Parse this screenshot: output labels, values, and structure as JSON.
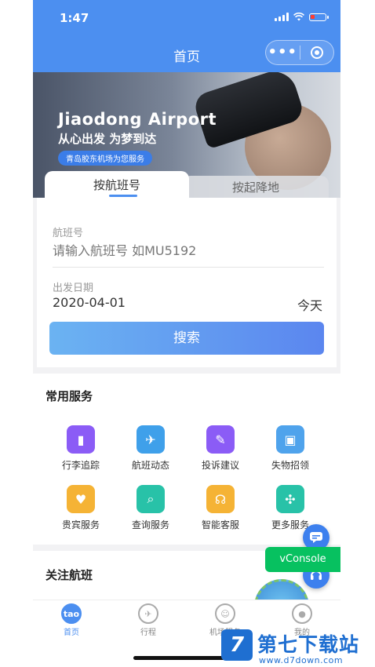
{
  "status": {
    "time": "1:47"
  },
  "navbar": {
    "title": "首页"
  },
  "banner": {
    "title": "Jiaodong Airport",
    "subtitle": "从心出发 为梦到达",
    "pill": "青岛胶东机场为您服务"
  },
  "tabs": [
    {
      "label": "按航班号",
      "active": true
    },
    {
      "label": "按起降地",
      "active": false
    }
  ],
  "search": {
    "flight_label": "航班号",
    "flight_placeholder": "请输入航班号 如MU5192",
    "date_label": "出发日期",
    "date_value": "2020-04-01",
    "date_hint": "今天",
    "button": "搜索"
  },
  "services": {
    "title": "常用服务",
    "items": [
      {
        "label": "行李追踪",
        "icon": "luggage-icon",
        "color": "#8b5cf6"
      },
      {
        "label": "航班动态",
        "icon": "airplane-icon",
        "color": "#3fa0ea"
      },
      {
        "label": "投诉建议",
        "icon": "edit-icon",
        "color": "#8b5cf6"
      },
      {
        "label": "失物招领",
        "icon": "wallet-icon",
        "color": "#4fa3ec"
      },
      {
        "label": "贵宾服务",
        "icon": "heart-icon",
        "color": "#f5b335"
      },
      {
        "label": "查询服务",
        "icon": "search-doc-icon",
        "color": "#28c2a8"
      },
      {
        "label": "智能客服",
        "icon": "headset-icon",
        "color": "#f5b335"
      },
      {
        "label": "更多服务",
        "icon": "grid-icon",
        "color": "#28c2a8"
      }
    ]
  },
  "follow": {
    "title": "关注航班"
  },
  "vconsole": {
    "label": "vConsole"
  },
  "tabbar": [
    {
      "label": "首页",
      "icon": "home-icon",
      "active": true,
      "glyph": "tao"
    },
    {
      "label": "行程",
      "icon": "trip-icon",
      "active": false,
      "glyph": ""
    },
    {
      "label": "机场服务",
      "icon": "smile-icon",
      "active": false,
      "glyph": ""
    },
    {
      "label": "我的",
      "icon": "user-icon",
      "active": false,
      "glyph": ""
    }
  ],
  "watermark": {
    "title": "第七下载站",
    "url": "www.d7down.com",
    "logo": "7"
  }
}
